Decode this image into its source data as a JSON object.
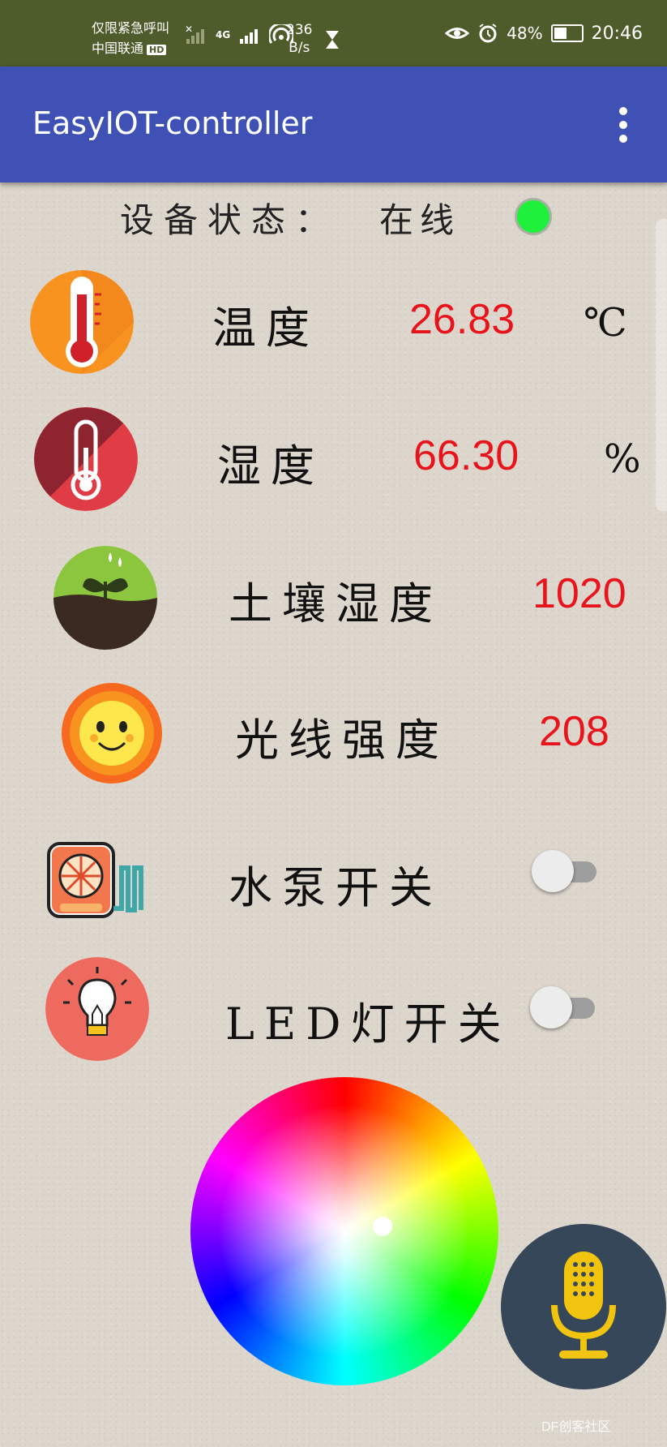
{
  "status_bar": {
    "carrier_line1": "仅限紧急呼叫",
    "carrier_line2": "中国联通",
    "hd_badge": "HD",
    "network_type": "4G",
    "net_speed_value": "236",
    "net_speed_unit": "B/s",
    "battery_percent": "48%",
    "battery_level": 0.48,
    "time": "20:46"
  },
  "app_bar": {
    "title": "EasyIOT-controller",
    "overflow_icon": "more-vert-icon"
  },
  "device_status": {
    "label": "设备状态：",
    "value": "在线",
    "indicator_color": "#1ef03c"
  },
  "sensors": [
    {
      "icon": "thermometer-orange-icon",
      "label": "温度",
      "value": "26.83",
      "unit": "℃"
    },
    {
      "icon": "thermometer-red-icon",
      "label": "湿度",
      "value": "66.30",
      "unit": "%"
    },
    {
      "icon": "soil-plant-icon",
      "label": "土壤湿度",
      "value": "1020"
    },
    {
      "icon": "sun-face-icon",
      "label": "光线强度",
      "value": "208"
    }
  ],
  "switches": [
    {
      "icon": "water-pump-icon",
      "label": "水泵开关",
      "state": "off"
    },
    {
      "icon": "light-bulb-icon",
      "label": "LED灯开关",
      "state": "off"
    }
  ],
  "color_picker": {
    "type": "color-wheel"
  },
  "voice_button": {
    "icon": "microphone-icon"
  },
  "watermark": "DF创客社区"
}
